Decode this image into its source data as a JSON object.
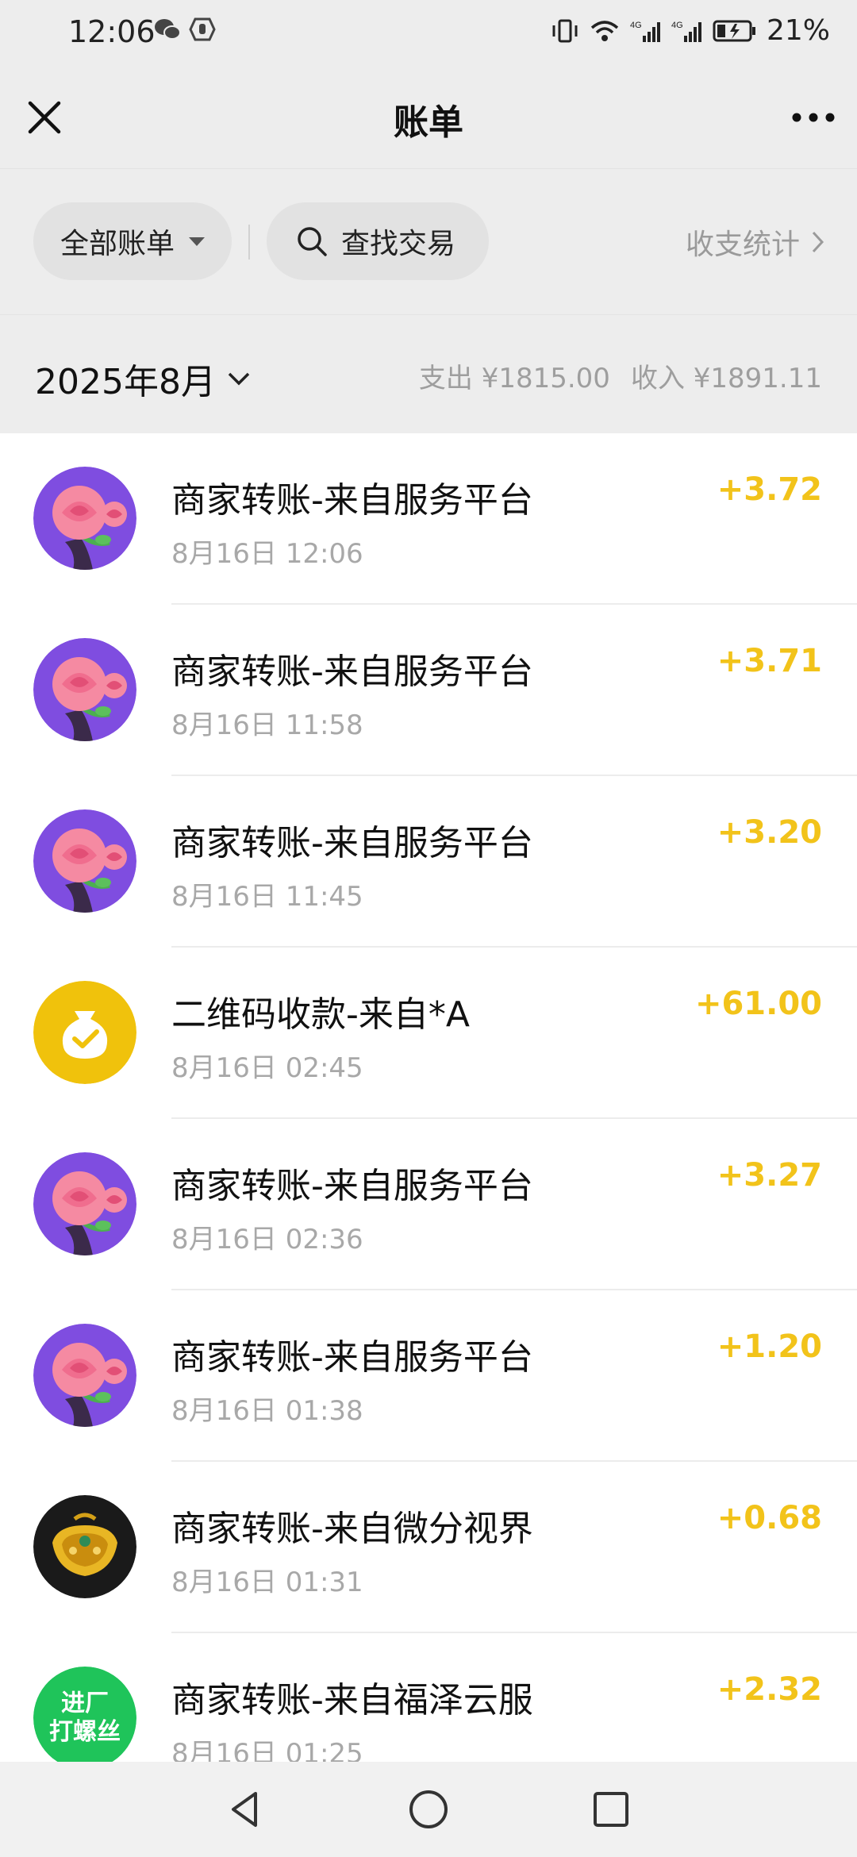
{
  "status_bar": {
    "time": "12:06",
    "battery_percent": "21%"
  },
  "nav": {
    "title": "账单"
  },
  "filters": {
    "all_bills": "全部账单",
    "search": "查找交易",
    "stats": "收支统计"
  },
  "month": {
    "label": "2025年8月",
    "expense": "支出 ¥1815.00",
    "income": "收入 ¥1891.11"
  },
  "transactions": [
    {
      "title": "商家转账-来自服务平台",
      "time": "8月16日 12:06",
      "amount": "+3.72",
      "avatar": "rose"
    },
    {
      "title": "商家转账-来自服务平台",
      "time": "8月16日 11:58",
      "amount": "+3.71",
      "avatar": "rose"
    },
    {
      "title": "商家转账-来自服务平台",
      "time": "8月16日 11:45",
      "amount": "+3.20",
      "avatar": "rose"
    },
    {
      "title": "二维码收款-来自*A",
      "time": "8月16日 02:45",
      "amount": "+61.00",
      "avatar": "money-bag"
    },
    {
      "title": "商家转账-来自服务平台",
      "time": "8月16日 02:36",
      "amount": "+3.27",
      "avatar": "rose"
    },
    {
      "title": "商家转账-来自服务平台",
      "time": "8月16日 01:38",
      "amount": "+1.20",
      "avatar": "rose"
    },
    {
      "title": "商家转账-来自微分视界",
      "time": "8月16日 01:31",
      "amount": "+0.68",
      "avatar": "gold-lock"
    },
    {
      "title": "商家转账-来自福泽云服",
      "time": "8月16日 01:25",
      "amount": "+2.32",
      "avatar": "green-badge",
      "avatar_text": [
        "进厂",
        "打螺丝"
      ]
    }
  ],
  "colors": {
    "amount": "#f2c31a",
    "background": "#ededed"
  }
}
